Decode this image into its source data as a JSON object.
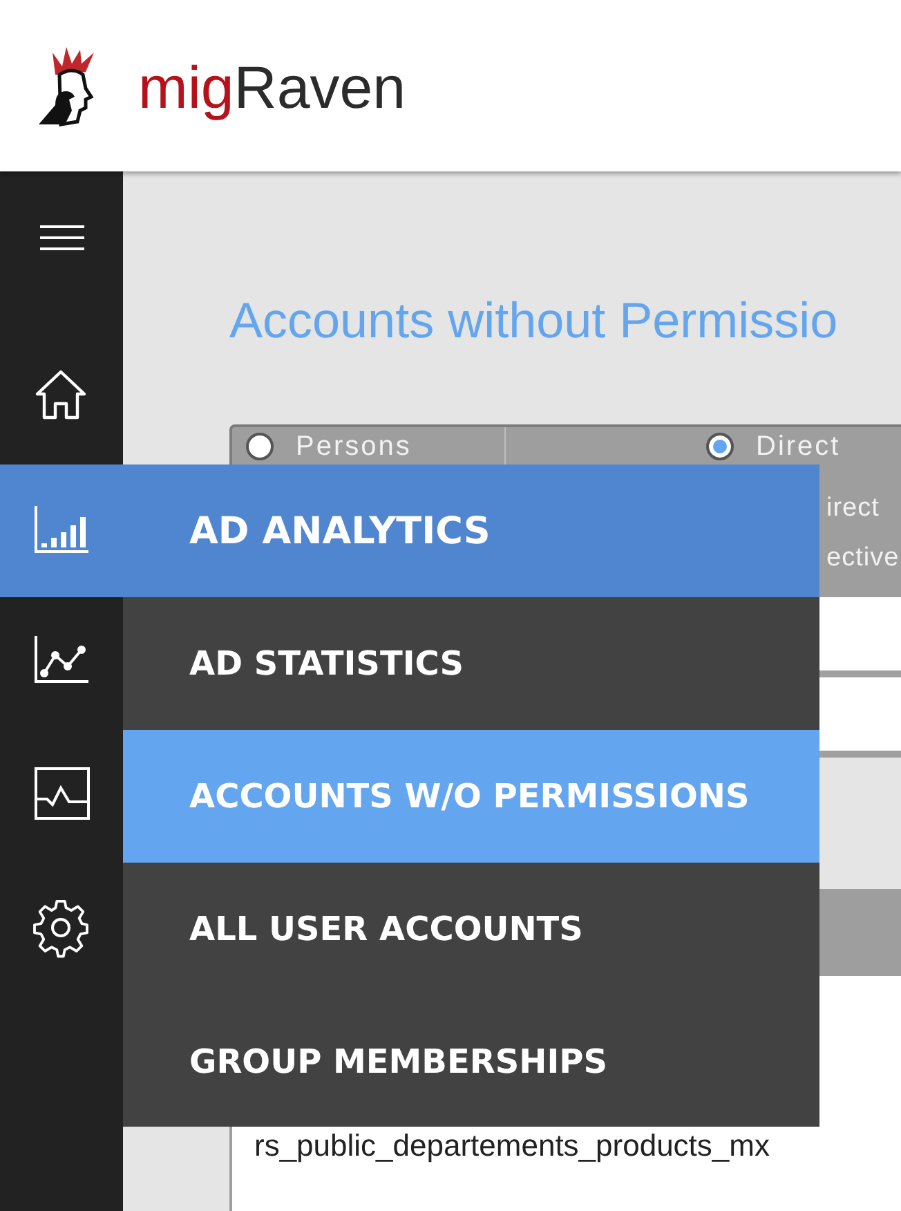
{
  "header": {
    "logo_prefix": "mig",
    "logo_suffix": "Raven"
  },
  "sidebar": {
    "items": [
      {
        "kind": "home",
        "selected": false
      },
      {
        "kind": "bars",
        "selected": true
      },
      {
        "kind": "trend",
        "selected": false
      },
      {
        "kind": "monitor",
        "selected": false
      },
      {
        "kind": "settings",
        "selected": false
      }
    ]
  },
  "page": {
    "title": "Accounts without Permissio",
    "filter": {
      "options": [
        {
          "label": "Persons",
          "selected": false
        },
        {
          "label": "Direct",
          "selected": true
        }
      ],
      "fragments": [
        "irect",
        "ective"
      ]
    },
    "table": {
      "rows": [
        [
          "rs_public_departements_products_mx"
        ]
      ]
    }
  },
  "menu": {
    "title": "AD ANALYTICS",
    "items": [
      {
        "label": "AD STATISTICS",
        "selected": false
      },
      {
        "label": "ACCOUNTS W/O PERMISSIONS",
        "selected": true
      },
      {
        "label": "ALL USER ACCOUNTS",
        "selected": false
      },
      {
        "label": "GROUP MEMBERSHIPS",
        "selected": false
      }
    ]
  }
}
